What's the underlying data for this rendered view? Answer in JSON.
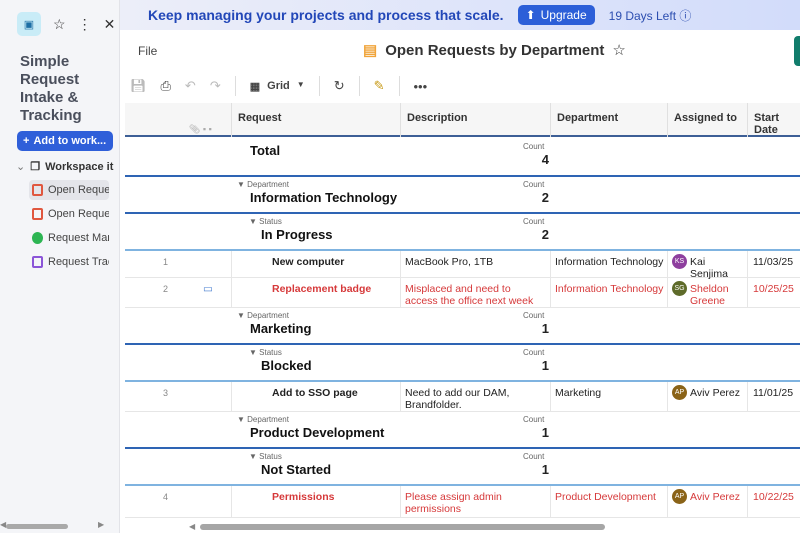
{
  "sidebar": {
    "title": "Simple Request Intake & Tracking",
    "add_label": "Add to work...",
    "workspace_label": "Workspace it",
    "items": [
      {
        "label": "Open Reque",
        "color": "#e0573f",
        "selected": true
      },
      {
        "label": "Open Reque",
        "color": "#e0573f"
      },
      {
        "label": "Request Mar",
        "color": "#2db553"
      },
      {
        "label": "Request Trac",
        "color": "#8b55d8"
      }
    ]
  },
  "banner": {
    "text": "Keep managing your projects and process that scale.",
    "upgrade": "Upgrade",
    "days_left": "19 Days Left"
  },
  "header": {
    "file": "File",
    "title": "Open Requests by Department"
  },
  "toolbar": {
    "view": "Grid"
  },
  "columns": [
    "Request",
    "Description",
    "Department",
    "Assigned to",
    "Start Date"
  ],
  "groups": {
    "total": {
      "label": "Total",
      "count_label": "Count",
      "count": "4"
    },
    "it": {
      "kind": "Department",
      "label": "Information Technology",
      "count_label": "Count",
      "count": "2"
    },
    "inprog": {
      "kind": "Status",
      "label": "In Progress",
      "count_label": "Count",
      "count": "2"
    },
    "mkt": {
      "kind": "Department",
      "label": "Marketing",
      "count_label": "Count",
      "count": "1"
    },
    "blocked": {
      "kind": "Status",
      "label": "Blocked",
      "count_label": "Count",
      "count": "1"
    },
    "pd": {
      "kind": "Department",
      "label": "Product Development",
      "count_label": "Count",
      "count": "1"
    },
    "ns": {
      "kind": "Status",
      "label": "Not Started",
      "count_label": "Count",
      "count": "1"
    }
  },
  "rows": [
    {
      "num": "1",
      "request": "New computer",
      "description": "MacBook Pro, 1TB",
      "department": "Information Technology",
      "initials": "KS",
      "avatar_color": "#8e3f9e",
      "assigned": "Kai Senjima",
      "start": "11/03/25",
      "overdue": false
    },
    {
      "num": "2",
      "request": "Replacement badge",
      "description": "Misplaced and need to access the office next week",
      "department": "Information Technology",
      "initials": "SG",
      "avatar_color": "#5e6b2a",
      "assigned": "Sheldon Greene",
      "start": "10/25/25",
      "overdue": true
    },
    {
      "num": "3",
      "request": "Add to SSO page",
      "description": "Need to add our DAM, Brandfolder.",
      "department": "Marketing",
      "initials": "AP",
      "avatar_color": "#8a6318",
      "assigned": "Aviv Perez",
      "start": "11/01/25",
      "overdue": false
    },
    {
      "num": "4",
      "request": "Permissions",
      "description": "Please assign admin permissions",
      "department": "Product Development",
      "initials": "AP",
      "avatar_color": "#8a6318",
      "assigned": "Aviv Perez",
      "start": "10/22/25",
      "overdue": true
    }
  ]
}
